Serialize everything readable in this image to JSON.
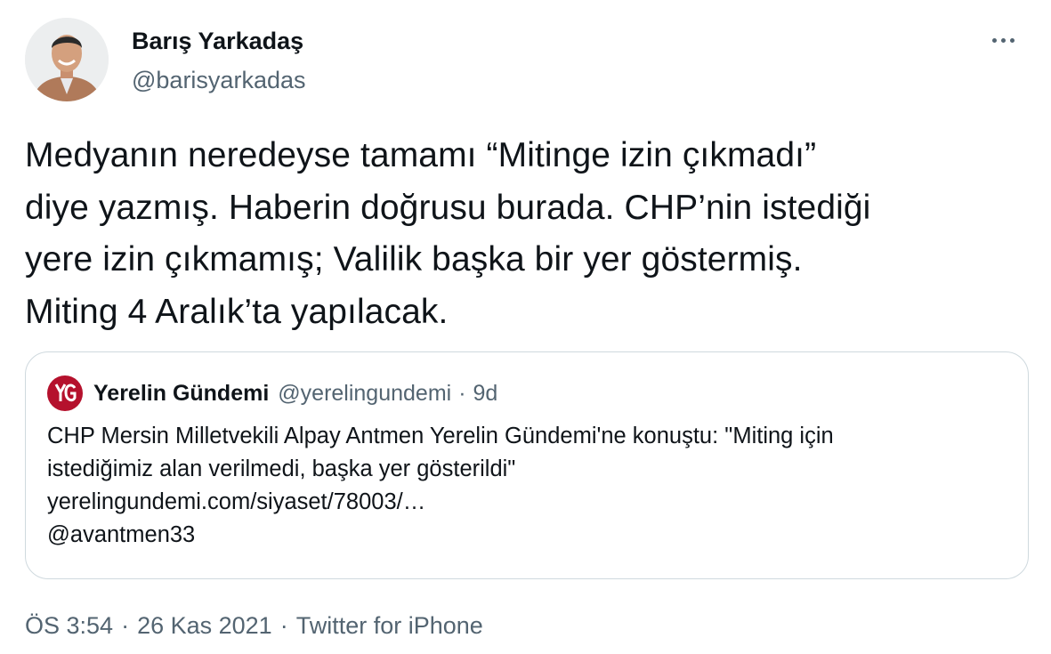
{
  "author": {
    "display_name": "Barış Yarkadaş",
    "handle": "@barisyarkadas"
  },
  "more_menu": {
    "icon": "more-horizontal-icon"
  },
  "tweet": {
    "lines": [
      "Medyanın neredeyse tamamı “Mitinge izin çıkmadı”",
      "diye yazmış. Haberin doğrusu burada. CHP’nin istediği",
      "yere izin çıkmamış; Valilik başka bir yer göstermiş.",
      "Miting 4 Aralık’ta yapılacak."
    ]
  },
  "quoted_tweet": {
    "display_name": "Yerelin Gündemi",
    "handle": "@yerelingundemi",
    "separator": "·",
    "time": "9d",
    "logo_color": "#b5112d",
    "lines": [
      "CHP Mersin Milletvekili Alpay Antmen Yerelin Gündemi'ne konuştu: \"Miting için",
      "istediğimiz alan verilmedi, başka yer gösterildi\"",
      "yerelingundemi.com/siyaset/78003/…",
      "@avantmen33"
    ]
  },
  "meta": {
    "time": "ÖS 3:54",
    "separator": "·",
    "date": "26 Kas 2021",
    "source": "Twitter for iPhone"
  }
}
